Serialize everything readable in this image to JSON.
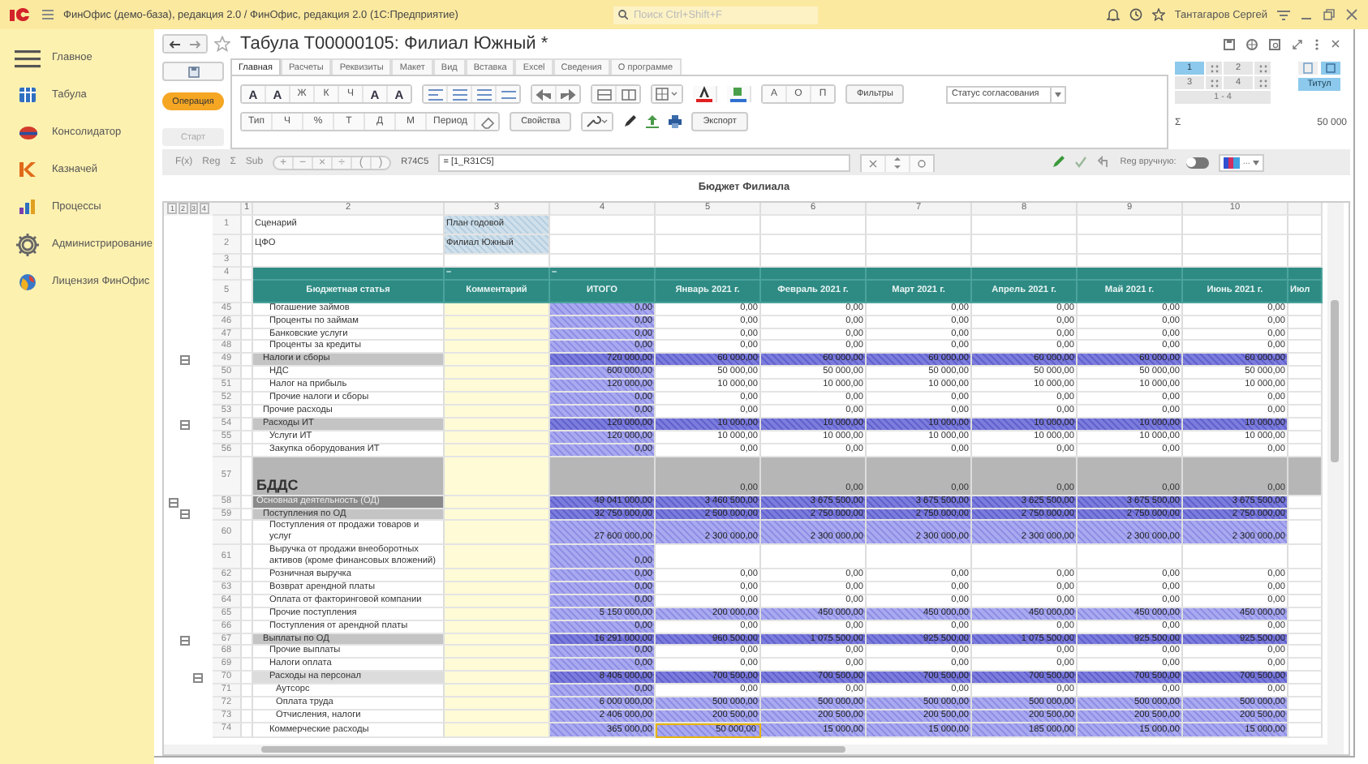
{
  "titlebar": {
    "title": "ФинОфис (демо-база), редакция 2.0 / ФинОфис, редакция 2.0  (1С:Предприятие)",
    "search_placeholder": "Поиск Ctrl+Shift+F",
    "user": "Тантагаров Сергей"
  },
  "sidebar": {
    "items": [
      {
        "label": "Главное",
        "kind": "menu"
      },
      {
        "label": "Табула",
        "kind": "tabula"
      },
      {
        "label": "Консолидатор",
        "kind": "consolidator"
      },
      {
        "label": "Казначей",
        "kind": "treasurer"
      },
      {
        "label": "Процессы",
        "kind": "processes"
      },
      {
        "label": "Администрирование",
        "kind": "gear"
      },
      {
        "label": "Лицензия ФинОфис",
        "kind": "globe"
      }
    ]
  },
  "document": {
    "title": "Табула Т00000105: Филиал Южный *"
  },
  "side_actions": [
    {
      "label": "Операция",
      "kind": "primary"
    },
    {
      "label": "Старт",
      "kind": "disabled"
    }
  ],
  "tabs": [
    {
      "label": "Главная",
      "selected": true
    },
    {
      "label": "Расчеты",
      "selected": false
    },
    {
      "label": "Реквизиты",
      "selected": false
    },
    {
      "label": "Макет",
      "selected": false
    },
    {
      "label": "Вид",
      "selected": false
    },
    {
      "label": "Вставка",
      "selected": false
    },
    {
      "label": "Excel",
      "selected": false
    },
    {
      "label": "Сведения",
      "selected": false
    },
    {
      "label": "О программе",
      "selected": false
    }
  ],
  "ribbon": {
    "font_buttons": [
      "A",
      "A",
      "Ж",
      "К",
      "Ч",
      "A",
      "A"
    ],
    "mark_buttons": [
      "А",
      "О",
      "П"
    ],
    "filters": "Фильтры",
    "status_select": "Статус согласования",
    "type_buttons": [
      "Тип",
      "Ч",
      "%",
      "Т",
      "Д",
      "М",
      "Период"
    ],
    "properties": "Свойства",
    "export": "Экспорт"
  },
  "pages_panel": {
    "pages": [
      {
        "label": "1",
        "selected": true
      },
      {
        "label": "2",
        "selected": false
      },
      {
        "label": "3",
        "selected": false
      },
      {
        "label": "4",
        "selected": false
      }
    ],
    "range": "1 - 4",
    "title_button": "Титул",
    "sum_sign": "Σ",
    "sum": "50 000"
  },
  "formula_bar": {
    "buttons": [
      "F(x)",
      "Reg",
      "Σ",
      "Sub"
    ],
    "ops": [
      "+",
      "−",
      "×",
      "÷",
      "(",
      ")"
    ],
    "cell": "R74C5",
    "formula": "= [1_R31C5]",
    "manual_label": "Reg вручную:",
    "manual_on": false,
    "color_label": "..."
  },
  "sheet": {
    "title": "Бюджет Филиала",
    "levels": [
      "1",
      "2",
      "3",
      "4"
    ],
    "column_numbers": [
      "1",
      "2",
      "3",
      "4",
      "5",
      "6",
      "7",
      "8",
      "9",
      "10"
    ],
    "params": [
      {
        "row": "1",
        "label": "Сценарий",
        "value": "План годовой"
      },
      {
        "row": "2",
        "label": "ЦФО",
        "value": "Филиал Южный"
      }
    ],
    "blank_row": "3",
    "dash_row": {
      "row": "4",
      "marks": [
        "–",
        "–"
      ]
    },
    "header": {
      "row": "5",
      "article": "Бюджетная статья",
      "comment": "Комментарий",
      "total": "ИТОГО",
      "months": [
        "Январь 2021 г.",
        "Февраль 2021 г.",
        "Март 2021 г.",
        "Апрель 2021 г.",
        "Май 2021 г.",
        "Июнь 2021 г.",
        "Июл"
      ]
    },
    "rows": [
      {
        "n": "45",
        "label": "Погашение займов",
        "kind": "item",
        "selected": false,
        "calculated": false,
        "total": "0,00",
        "months": [
          "0,00",
          "0,00",
          "0,00",
          "0,00",
          "0,00",
          "0,00"
        ]
      },
      {
        "n": "46",
        "label": "Проценты по займам",
        "kind": "item",
        "selected": false,
        "calculated": false,
        "total": "0,00",
        "months": [
          "0,00",
          "0,00",
          "0,00",
          "0,00",
          "0,00",
          "0,00"
        ]
      },
      {
        "n": "47",
        "label": "Банковские услуги",
        "kind": "item",
        "selected": false,
        "calculated": false,
        "total": "0,00",
        "months": [
          "0,00",
          "0,00",
          "0,00",
          "0,00",
          "0,00",
          "0,00"
        ]
      },
      {
        "n": "48",
        "label": "Проценты за кредиты",
        "kind": "item",
        "selected": false,
        "calculated": false,
        "total": "0,00",
        "months": [
          "0,00",
          "0,00",
          "0,00",
          "0,00",
          "0,00",
          "0,00"
        ]
      },
      {
        "n": "49",
        "label": "Налоги и сборы",
        "kind": "group",
        "expanded": true,
        "selected": false,
        "calculated": true,
        "total": "720 000,00",
        "months": [
          "60 000,00",
          "60 000,00",
          "60 000,00",
          "60 000,00",
          "60 000,00",
          "60 000,00"
        ]
      },
      {
        "n": "50",
        "label": "НДС",
        "kind": "item",
        "selected": false,
        "calculated": false,
        "total": "600 000,00",
        "months": [
          "50 000,00",
          "50 000,00",
          "50 000,00",
          "50 000,00",
          "50 000,00",
          "50 000,00"
        ]
      },
      {
        "n": "51",
        "label": "Налог на прибыль",
        "kind": "item",
        "selected": false,
        "calculated": false,
        "total": "120 000,00",
        "months": [
          "10 000,00",
          "10 000,00",
          "10 000,00",
          "10 000,00",
          "10 000,00",
          "10 000,00"
        ]
      },
      {
        "n": "52",
        "label": "Прочие налоги и сборы",
        "kind": "item",
        "selected": false,
        "calculated": false,
        "total": "0,00",
        "months": [
          "0,00",
          "0,00",
          "0,00",
          "0,00",
          "0,00",
          "0,00"
        ]
      },
      {
        "n": "53",
        "label": "Прочие расходы",
        "kind": "plain",
        "selected": false,
        "calculated": false,
        "total": "0,00",
        "months": [
          "0,00",
          "0,00",
          "0,00",
          "0,00",
          "0,00",
          "0,00"
        ]
      },
      {
        "n": "54",
        "label": "Расходы ИТ",
        "kind": "group",
        "expanded": true,
        "selected": false,
        "calculated": true,
        "total": "120 000,00",
        "months": [
          "10 000,00",
          "10 000,00",
          "10 000,00",
          "10 000,00",
          "10 000,00",
          "10 000,00"
        ]
      },
      {
        "n": "55",
        "label": "Услуги ИТ",
        "kind": "item",
        "selected": false,
        "calculated": false,
        "total": "120 000,00",
        "months": [
          "10 000,00",
          "10 000,00",
          "10 000,00",
          "10 000,00",
          "10 000,00",
          "10 000,00"
        ]
      },
      {
        "n": "56",
        "label": "Закупка оборудования ИТ",
        "kind": "item",
        "selected": false,
        "calculated": false,
        "total": "0,00",
        "months": [
          "0,00",
          "0,00",
          "0,00",
          "0,00",
          "0,00",
          "0,00"
        ]
      },
      {
        "n": "57",
        "label": "БДДС",
        "kind": "section",
        "selected": false,
        "calculated": false,
        "total": "",
        "months": [
          "0,00",
          "0,00",
          "0,00",
          "0,00",
          "0,00",
          "0,00"
        ]
      },
      {
        "n": "58",
        "label": "Основная деятельность (ОД)",
        "kind": "top",
        "expanded": true,
        "selected": false,
        "calculated": true,
        "total": "49 041 000,00",
        "months": [
          "3 460 500,00",
          "3 675 500,00",
          "3 675 500,00",
          "3 625 500,00",
          "3 675 500,00",
          "3 675 500,00"
        ]
      },
      {
        "n": "59",
        "label": "Поступления по ОД",
        "kind": "group",
        "expanded": true,
        "selected": false,
        "calculated": true,
        "total": "32 750 000,00",
        "months": [
          "2 500 000,00",
          "2 750 000,00",
          "2 750 000,00",
          "2 750 000,00",
          "2 750 000,00",
          "2 750 000,00"
        ]
      },
      {
        "n": "60",
        "label": "Поступления от продажи товаров и услуг",
        "kind": "item",
        "selected": false,
        "calculated": true,
        "total": "27 600 000,00",
        "months": [
          "2 300 000,00",
          "2 300 000,00",
          "2 300 000,00",
          "2 300 000,00",
          "2 300 000,00",
          "2 300 000,00"
        ]
      },
      {
        "n": "61",
        "label": "Выручка от продажи внеоборотных активов (кроме финансовых вложений)",
        "kind": "item",
        "selected": false,
        "total": "0,00",
        "months": []
      },
      {
        "n": "62",
        "label": "Розничная выручка",
        "kind": "item",
        "selected": false,
        "calculated": false,
        "total": "0,00",
        "months": [
          "0,00",
          "0,00",
          "0,00",
          "0,00",
          "0,00",
          "0,00"
        ]
      },
      {
        "n": "63",
        "label": "Возврат арендной платы",
        "kind": "item",
        "selected": false,
        "calculated": false,
        "total": "0,00",
        "months": [
          "0,00",
          "0,00",
          "0,00",
          "0,00",
          "0,00",
          "0,00"
        ]
      },
      {
        "n": "64",
        "label": "Оплата от факторинговой компании",
        "kind": "item",
        "selected": false,
        "calculated": false,
        "total": "0,00",
        "months": [
          "0,00",
          "0,00",
          "0,00",
          "0,00",
          "0,00",
          "0,00"
        ]
      },
      {
        "n": "65",
        "label": "Прочие поступления",
        "kind": "item",
        "selected": false,
        "calculated": true,
        "total": "5 150 000,00",
        "months": [
          "200 000,00",
          "450 000,00",
          "450 000,00",
          "450 000,00",
          "450 000,00",
          "450 000,00"
        ]
      },
      {
        "n": "66",
        "label": "Поступления от арендной платы",
        "kind": "item",
        "selected": false,
        "calculated": false,
        "total": "0,00",
        "months": [
          "0,00",
          "0,00",
          "0,00",
          "0,00",
          "0,00",
          "0,00"
        ]
      },
      {
        "n": "67",
        "label": "Выплаты по ОД",
        "kind": "group",
        "expanded": true,
        "selected": false,
        "calculated": true,
        "total": "16 291 000,00",
        "months": [
          "960 500,00",
          "1 075 500,00",
          "925 500,00",
          "1 075 500,00",
          "925 500,00",
          "925 500,00"
        ]
      },
      {
        "n": "68",
        "label": "Прочие выплаты",
        "kind": "item",
        "selected": false,
        "calculated": false,
        "total": "0,00",
        "months": [
          "0,00",
          "0,00",
          "0,00",
          "0,00",
          "0,00",
          "0,00"
        ]
      },
      {
        "n": "69",
        "label": "Налоги оплата",
        "kind": "item",
        "selected": false,
        "calculated": false,
        "total": "0,00",
        "months": [
          "0,00",
          "0,00",
          "0,00",
          "0,00",
          "0,00",
          "0,00"
        ]
      },
      {
        "n": "70",
        "label": "Расходы на персонал",
        "kind": "subgroup",
        "expanded": true,
        "selected": false,
        "calculated": true,
        "total": "8 406 000,00",
        "months": [
          "700 500,00",
          "700 500,00",
          "700 500,00",
          "700 500,00",
          "700 500,00",
          "700 500,00"
        ]
      },
      {
        "n": "71",
        "label": "Аутсорс",
        "kind": "subitem",
        "selected": false,
        "calculated": false,
        "total": "0,00",
        "months": [
          "0,00",
          "0,00",
          "0,00",
          "0,00",
          "0,00",
          "0,00"
        ]
      },
      {
        "n": "72",
        "label": "Оплата труда",
        "kind": "subitem",
        "selected": false,
        "calculated": true,
        "total": "6 000 000,00",
        "months": [
          "500 000,00",
          "500 000,00",
          "500 000,00",
          "500 000,00",
          "500 000,00",
          "500 000,00"
        ]
      },
      {
        "n": "73",
        "label": "Отчисления, налоги",
        "kind": "subitem",
        "selected": false,
        "calculated": true,
        "total": "2 406 000,00",
        "months": [
          "200 500,00",
          "200 500,00",
          "200 500,00",
          "200 500,00",
          "200 500,00",
          "200 500,00"
        ]
      },
      {
        "n": "74",
        "label": "Коммерческие расходы",
        "kind": "item",
        "selected": true,
        "calculated": true,
        "total": "365 000,00",
        "months": [
          "50 000,00",
          "15 000,00",
          "15 000,00",
          "185 000,00",
          "15 000,00",
          "15 000,00"
        ]
      }
    ]
  }
}
